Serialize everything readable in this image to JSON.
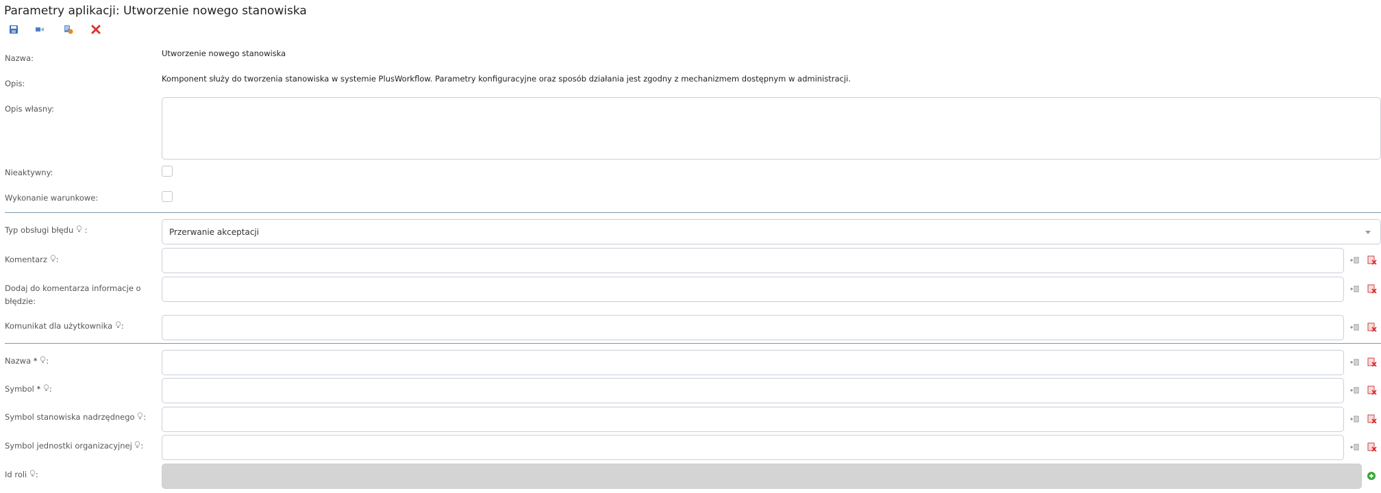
{
  "header": {
    "title": "Parametry aplikacji: Utworzenie nowego stanowiska"
  },
  "toolbar": {
    "icons": [
      "save-icon",
      "save-and-close-icon",
      "test-icon",
      "close-icon"
    ]
  },
  "fields": {
    "nazwa_label": "Nazwa:",
    "nazwa_value": "Utworzenie nowego stanowiska",
    "opis_label": "Opis:",
    "opis_value": "Komponent służy do tworzenia stanowiska w systemie PlusWorkflow. Parametry konfiguracyjne oraz sposób działania jest zgodny z mechanizmem dostępnym w administracji.",
    "opis_wlasny_label": "Opis własny:",
    "opis_wlasny_value": "",
    "nieaktywny_label": "Nieaktywny:",
    "wykonanie_label": "Wykonanie warunkowe:"
  },
  "error_section": {
    "typ_label": "Typ obsługi błędu",
    "typ_value": "Przerwanie akceptacji",
    "komentarz_label": "Komentarz",
    "dodaj_label": "Dodaj do komentarza informacje o błędzie:",
    "komunikat_label": "Komunikat dla użytkownika"
  },
  "params": {
    "nazwa_label": "Nazwa",
    "symbol_label": "Symbol",
    "nadrzedny_label": "Symbol stanowiska nadrzędnego",
    "jednostka_label": "Symbol jednostki organizacyjnej",
    "id_roli_label": "Id roli"
  },
  "common": {
    "required_mark": "*",
    "colon": ":"
  },
  "colors": {
    "separator": "#7c98a8",
    "close_red": "#e0312a",
    "add_green": "#3aa63a"
  }
}
